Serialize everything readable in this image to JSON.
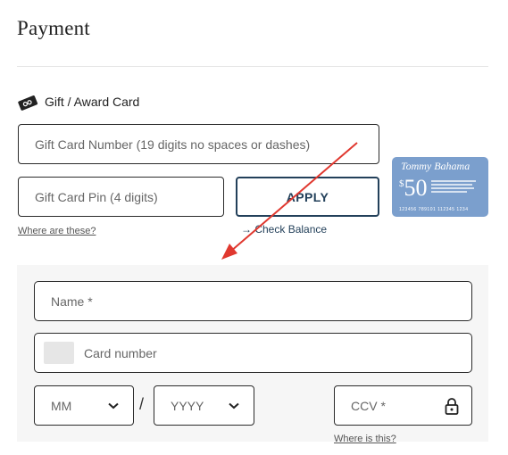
{
  "page": {
    "title": "Payment"
  },
  "gift_card": {
    "section_label": "Gift / Award Card",
    "number_placeholder": "Gift Card Number (19 digits no spaces or dashes)",
    "pin_placeholder": "Gift Card Pin (4 digits)",
    "apply_label": "APPLY",
    "check_balance_label": "Check Balance",
    "where_label": "Where are these?",
    "card_image": {
      "brand": "Tommy Bahama",
      "amount": "50",
      "card_number": "123456 789101 112345  1234"
    }
  },
  "credit_card": {
    "name_placeholder": "Name *",
    "number_placeholder": "Card number",
    "month_placeholder": "MM",
    "year_placeholder": "YYYY",
    "separator": "/",
    "ccv_placeholder": "CCV *",
    "where_label": "Where is this?"
  },
  "icons": {
    "gift": "gift-card-icon",
    "check_balance": "arrow-right-icon",
    "lock": "lock-icon",
    "dropdown": "chevron-down-icon"
  },
  "colors": {
    "accent": "#23405a",
    "annotation_arrow": "#e0382f",
    "card_blue": "#7b9fcd",
    "panel_bg": "#f6f6f6"
  }
}
